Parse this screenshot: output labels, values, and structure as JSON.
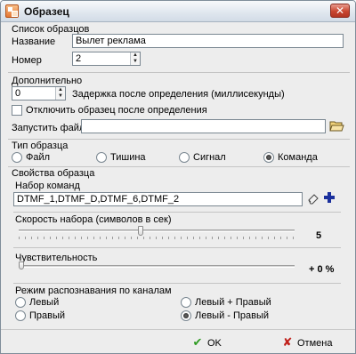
{
  "window": {
    "title": "Образец",
    "close_glyph": "✕"
  },
  "samples": {
    "group_title": "Список образцов",
    "name_label": "Название",
    "name_value": "Вылет реклама",
    "number_label": "Номер",
    "number_value": "2"
  },
  "extra": {
    "group_title": "Дополнительно",
    "delay_value": "0",
    "delay_label": "Задержка после определения (миллисекунды)",
    "disable_label": "Отключить образец после определения",
    "disable_checked": false,
    "run_file_label": "Запустить файл",
    "run_file_value": ""
  },
  "sample_type": {
    "group_title": "Тип образца",
    "options": [
      "Файл",
      "Тишина",
      "Сигнал",
      "Команда"
    ],
    "selected": "Команда"
  },
  "props": {
    "group_title": "Свойства образца",
    "commands_label": "Набор команд",
    "commands_value": "DTMF_1,DTMF_D,DTMF_6,DTMF_2",
    "speed_label": "Скорость набора (символов в сек)",
    "speed_value": 5,
    "speed_display": "5",
    "speed_fraction": 0.44,
    "sensitivity_label": "Чувствительность",
    "sensitivity_value": 0,
    "sensitivity_display": "+ 0 %",
    "sensitivity_fraction": 0.0
  },
  "channels": {
    "group_title": "Режим распознавания по каналам",
    "options": [
      "Левый",
      "Правый",
      "Левый + Правый",
      "Левый - Правый"
    ],
    "selected": "Левый - Правый"
  },
  "footer": {
    "ok_label": "OK",
    "ok_glyph": "✔",
    "cancel_label": "Отмена",
    "cancel_glyph": "✘"
  },
  "colors": {
    "ok_icon": "#2e9b22",
    "cancel_icon": "#c0201a",
    "add_icon": "#1a2f9c"
  }
}
